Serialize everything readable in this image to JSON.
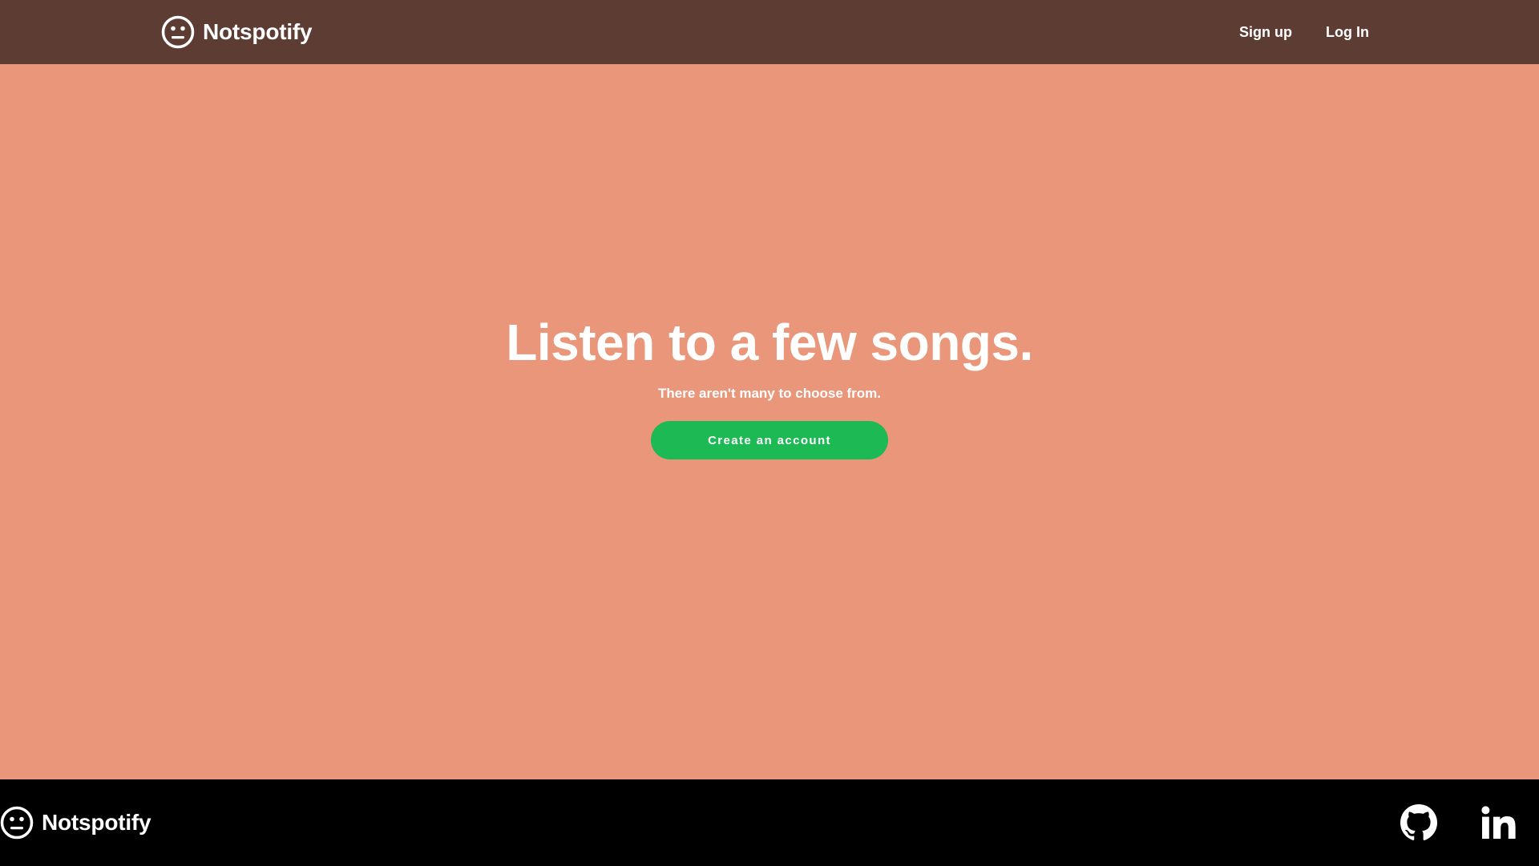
{
  "header": {
    "brand_name": "Notspotify",
    "brand_icon": "neutral-face-icon",
    "nav": {
      "signup_label": "Sign up",
      "login_label": "Log In"
    }
  },
  "hero": {
    "title": "Listen to a few songs.",
    "subtitle": "There aren't many to choose from.",
    "cta_label": "Create an account"
  },
  "footer": {
    "brand_name": "Notspotify",
    "brand_icon": "neutral-face-icon",
    "social_icons": [
      "github-icon",
      "linkedin-icon"
    ]
  },
  "colors": {
    "header_bg": "#5c3c33",
    "hero_bg": "#e9967a",
    "cta_bg": "#1db954",
    "footer_bg": "#000000",
    "text": "#ffffff"
  }
}
